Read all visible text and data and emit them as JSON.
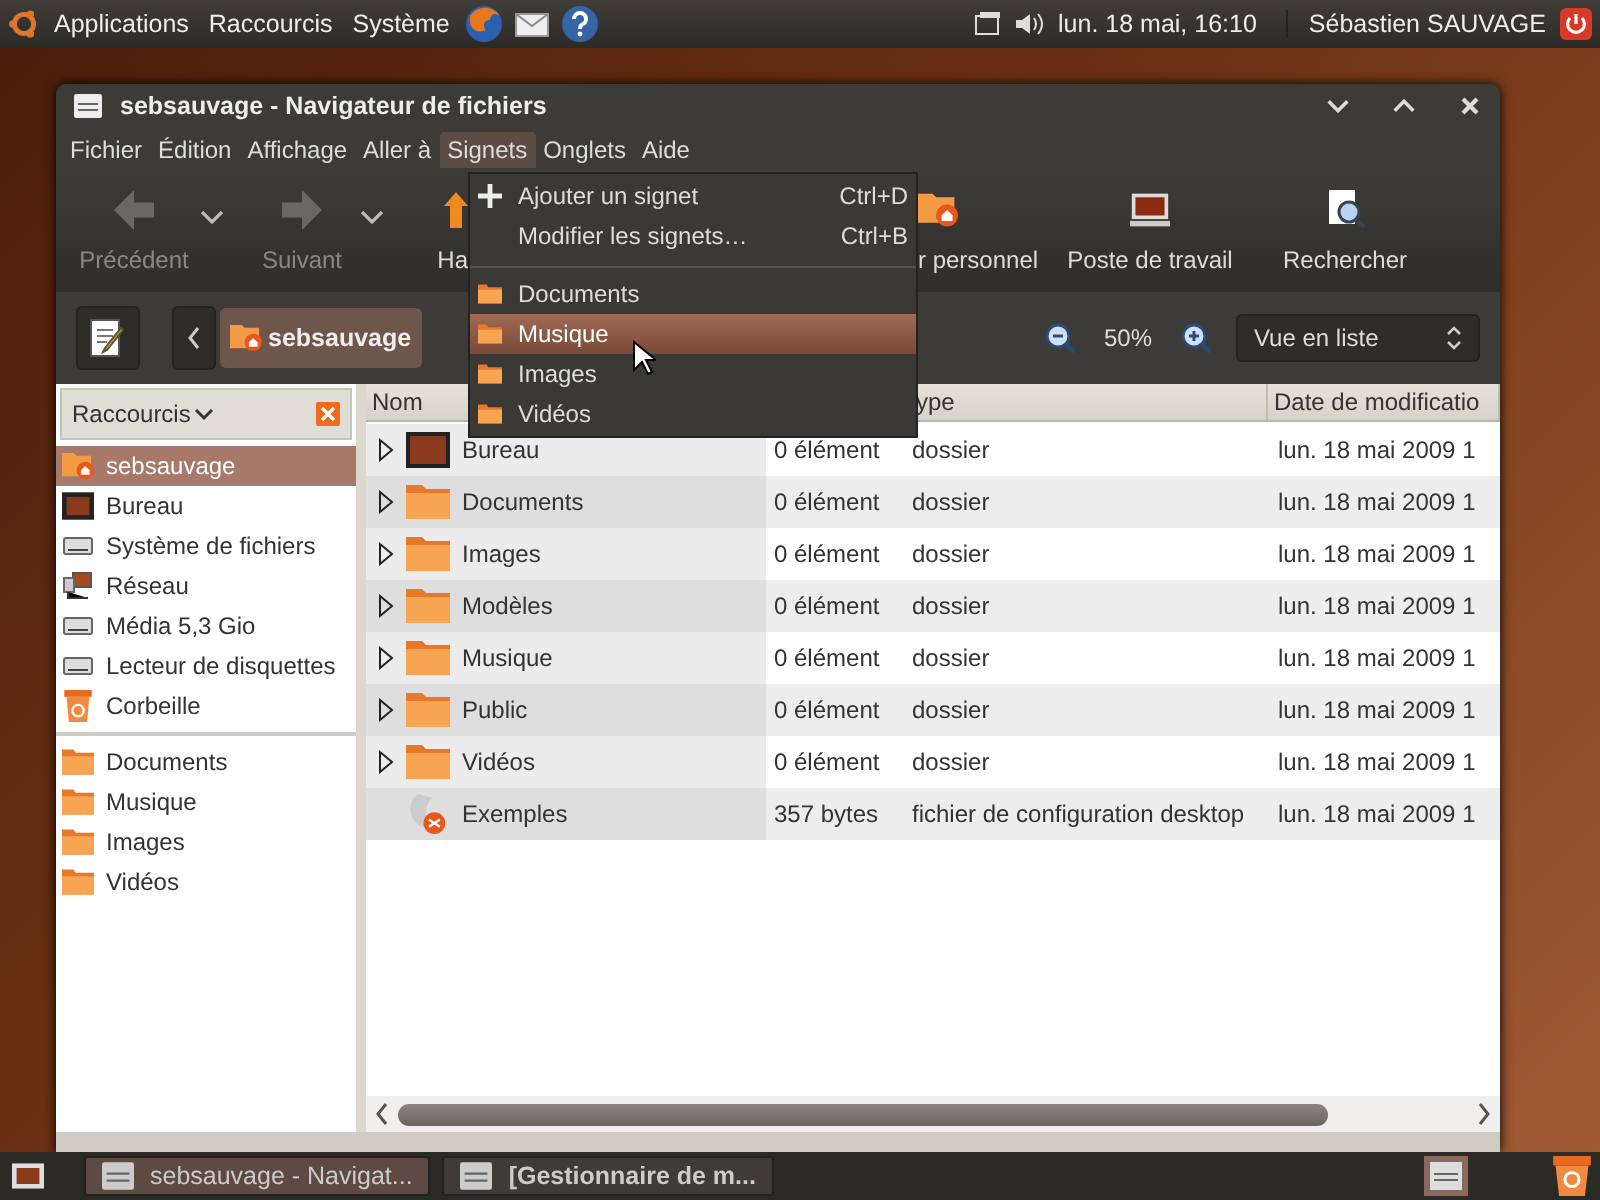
{
  "top_panel": {
    "menus": [
      "Applications",
      "Raccourcis",
      "Système"
    ],
    "clock": "lun. 18 mai, 16:10",
    "user": "Sébastien SAUVAGE"
  },
  "window": {
    "title": "sebsauvage - Navigateur de fichiers",
    "menu_bar": [
      {
        "label": "Fichier",
        "selected": false
      },
      {
        "label": "Édition",
        "selected": false
      },
      {
        "label": "Affichage",
        "selected": false
      },
      {
        "label": "Aller à",
        "selected": false
      },
      {
        "label": "Signets",
        "selected": true
      },
      {
        "label": "Onglets",
        "selected": false
      },
      {
        "label": "Aide",
        "selected": false
      }
    ],
    "open_menu": [
      {
        "kind": "add",
        "label": "Ajouter un signet",
        "shortcut": "Ctrl+D",
        "hovered": false
      },
      {
        "kind": "action",
        "label": "Modifier les signets…",
        "shortcut": "Ctrl+B",
        "hovered": false
      },
      {
        "kind": "separator"
      },
      {
        "kind": "bookmark",
        "label": "Documents",
        "hovered": false
      },
      {
        "kind": "bookmark",
        "label": "Musique",
        "hovered": true
      },
      {
        "kind": "bookmark",
        "label": "Images",
        "hovered": false
      },
      {
        "kind": "bookmark",
        "label": "Vidéos",
        "hovered": false
      }
    ],
    "toolbar": [
      {
        "label": "Précédent",
        "kind": "back",
        "disabled": true,
        "dropdown": true
      },
      {
        "label": "Suivant",
        "kind": "forward",
        "disabled": true,
        "dropdown": true
      },
      {
        "label": "Ha",
        "kind": "up",
        "disabled": false,
        "dropdown": false
      },
      {
        "label": "r personnel",
        "kind": "home",
        "disabled": false,
        "dropdown": false
      },
      {
        "label": "Poste de travail",
        "kind": "computer",
        "disabled": false,
        "dropdown": false
      },
      {
        "label": "Rechercher",
        "kind": "search",
        "disabled": false,
        "dropdown": false
      }
    ],
    "location": {
      "path": "sebsauvage",
      "zoom": "50%",
      "view": "Vue en liste"
    },
    "sidebar": {
      "header": "Raccourcis",
      "places": [
        {
          "label": "sebsauvage",
          "kind": "home",
          "selected": true
        },
        {
          "label": "Bureau",
          "kind": "desktop",
          "selected": false
        },
        {
          "label": "Système de fichiers",
          "kind": "drive",
          "selected": false
        },
        {
          "label": "Réseau",
          "kind": "network",
          "selected": false
        },
        {
          "label": "Média 5,3 Gio",
          "kind": "drive",
          "selected": false
        },
        {
          "label": "Lecteur de disquettes",
          "kind": "drive",
          "selected": false
        },
        {
          "label": "Corbeille",
          "kind": "trash",
          "selected": false
        }
      ],
      "bookmarks": [
        {
          "label": "Documents",
          "selected": false
        },
        {
          "label": "Musique",
          "selected": false
        },
        {
          "label": "Images",
          "selected": false
        },
        {
          "label": "Vidéos",
          "selected": false
        }
      ]
    },
    "table": {
      "columns": {
        "name": "Nom",
        "type": "ype",
        "date": "Date de modificatio"
      },
      "rows": [
        {
          "name": "Bureau",
          "kind": "desktop",
          "expandable": true,
          "size": "0 élément",
          "type": "dossier",
          "date": "lun. 18 mai 2009 1"
        },
        {
          "name": "Documents",
          "kind": "folder",
          "expandable": true,
          "size": "0 élément",
          "type": "dossier",
          "date": "lun. 18 mai 2009 1"
        },
        {
          "name": "Images",
          "kind": "folder",
          "expandable": true,
          "size": "0 élément",
          "type": "dossier",
          "date": "lun. 18 mai 2009 1"
        },
        {
          "name": "Modèles",
          "kind": "folder",
          "expandable": true,
          "size": "0 élément",
          "type": "dossier",
          "date": "lun. 18 mai 2009 1"
        },
        {
          "name": "Musique",
          "kind": "folder",
          "expandable": true,
          "size": "0 élément",
          "type": "dossier",
          "date": "lun. 18 mai 2009 1"
        },
        {
          "name": "Public",
          "kind": "folder",
          "expandable": true,
          "size": "0 élément",
          "type": "dossier",
          "date": "lun. 18 mai 2009 1"
        },
        {
          "name": "Vidéos",
          "kind": "folder",
          "expandable": true,
          "size": "0 élément",
          "type": "dossier",
          "date": "lun. 18 mai 2009 1"
        },
        {
          "name": "Exemples",
          "kind": "link",
          "expandable": false,
          "size": "357 bytes",
          "type": "fichier de configuration desktop",
          "date": "lun. 18 mai 2009 1"
        }
      ]
    }
  },
  "taskbar": [
    {
      "label": "sebsauvage - Navigat...",
      "selected": true,
      "attention": false
    },
    {
      "label": "[Gestionnaire de m...",
      "selected": false,
      "attention": true
    }
  ]
}
